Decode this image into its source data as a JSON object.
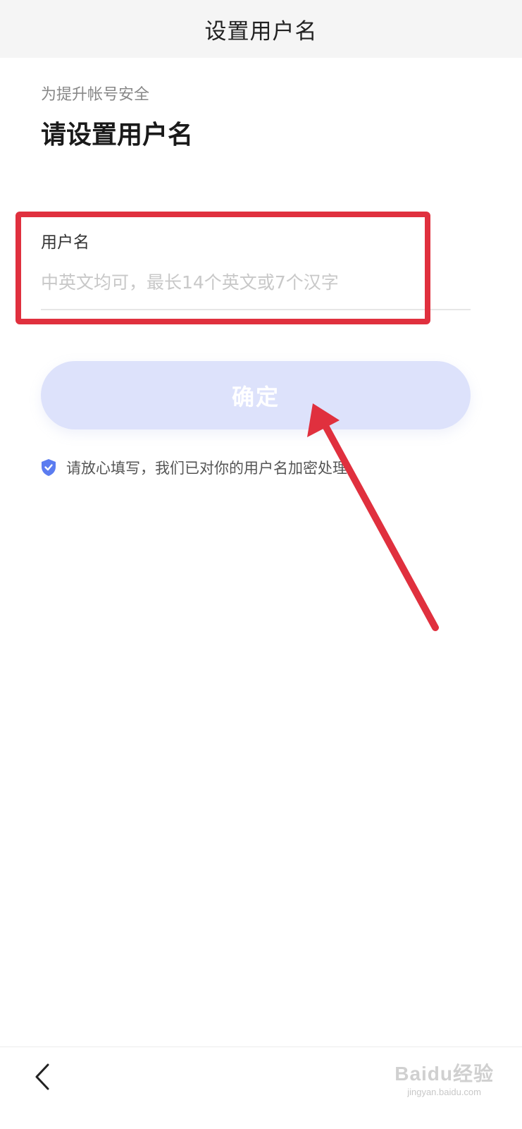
{
  "header": {
    "title": "设置用户名"
  },
  "intro": {
    "subtitle": "为提升帐号安全",
    "heading": "请设置用户名"
  },
  "username_field": {
    "label": "用户名",
    "value": "",
    "placeholder": "中英文均可，最长14个英文或7个汉字"
  },
  "confirm_button": {
    "label": "确定"
  },
  "notice": {
    "icon": "shield-check-icon",
    "text": "请放心填写，我们已对你的用户名加密处理"
  },
  "footer": {
    "back_icon": "chevron-left-icon",
    "watermark_logo": "Baidu经验",
    "watermark_url": "jingyan.baidu.com"
  },
  "colors": {
    "header_bg": "#f5f5f5",
    "button_bg_disabled": "#dde2fb",
    "shield_blue": "#5b7cf0",
    "annotation_red": "#e0303e"
  }
}
